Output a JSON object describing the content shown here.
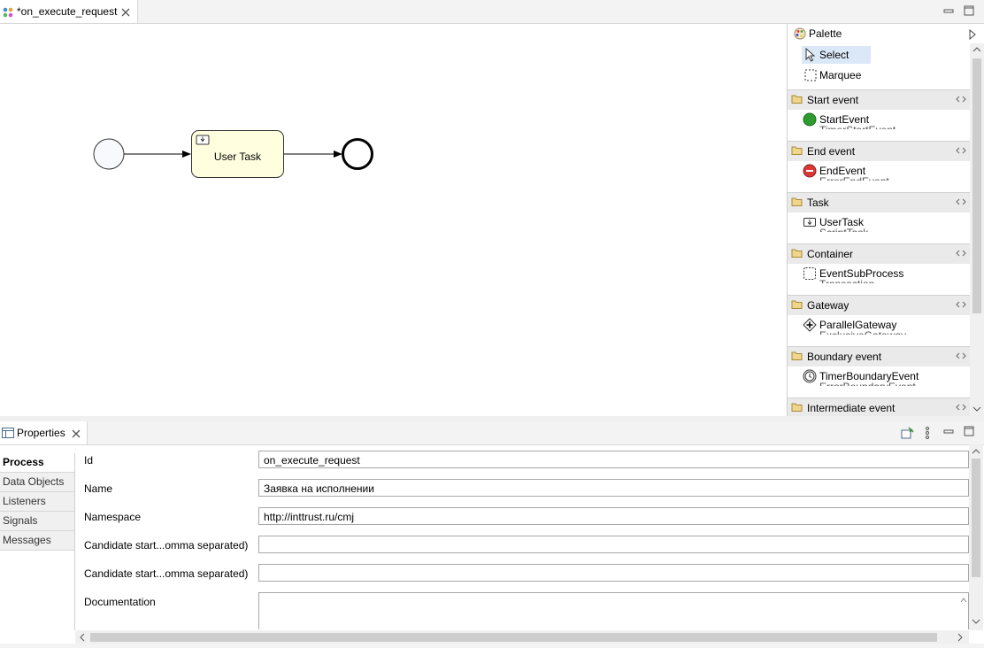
{
  "editor": {
    "tab_title": "*on_execute_request"
  },
  "diagram": {
    "user_task_label": "User Task"
  },
  "palette": {
    "title": "Palette",
    "tools": [
      {
        "label": "Select",
        "icon": "arrow-cursor-icon",
        "selected": true
      },
      {
        "label": "Marquee",
        "icon": "marquee-icon"
      }
    ],
    "groups": [
      {
        "name": "Start event",
        "item": "StartEvent",
        "icon": "start-event-icon",
        "clipped": "TimerStartEvent"
      },
      {
        "name": "End event",
        "item": "EndEvent",
        "icon": "end-event-icon",
        "clipped": "ErrorEndEvent"
      },
      {
        "name": "Task",
        "item": "UserTask",
        "icon": "user-task-icon",
        "clipped": "ScriptTask"
      },
      {
        "name": "Container",
        "item": "EventSubProcess",
        "icon": "event-subprocess-icon",
        "clipped": "Transaction"
      },
      {
        "name": "Gateway",
        "item": "ParallelGateway",
        "icon": "parallel-gateway-icon",
        "clipped": "ExclusiveGateway"
      },
      {
        "name": "Boundary event",
        "item": "TimerBoundaryEvent",
        "icon": "timer-boundary-icon",
        "clipped": "ErrorBoundaryEvent"
      },
      {
        "name": "Intermediate event"
      }
    ]
  },
  "properties": {
    "title": "Properties",
    "tabs": [
      "Process",
      "Data Objects",
      "Listeners",
      "Signals",
      "Messages"
    ],
    "active_tab": "Process",
    "fields": [
      {
        "label": "Id",
        "value": "on_execute_request"
      },
      {
        "label": "Name",
        "value": "Заявка на исполнении"
      },
      {
        "label": "Namespace",
        "value": "http://inttrust.ru/cmj"
      },
      {
        "label": "Candidate start...omma separated)",
        "value": ""
      },
      {
        "label": "Candidate start...omma separated)",
        "value": ""
      }
    ],
    "documentation_label": "Documentation",
    "documentation_value": ""
  },
  "colors": {
    "task_fill": "#ffffe0",
    "selected_tool": "#dbe8f8",
    "start_event_green": "#2e9b2e",
    "end_event_red": "#d83838"
  }
}
